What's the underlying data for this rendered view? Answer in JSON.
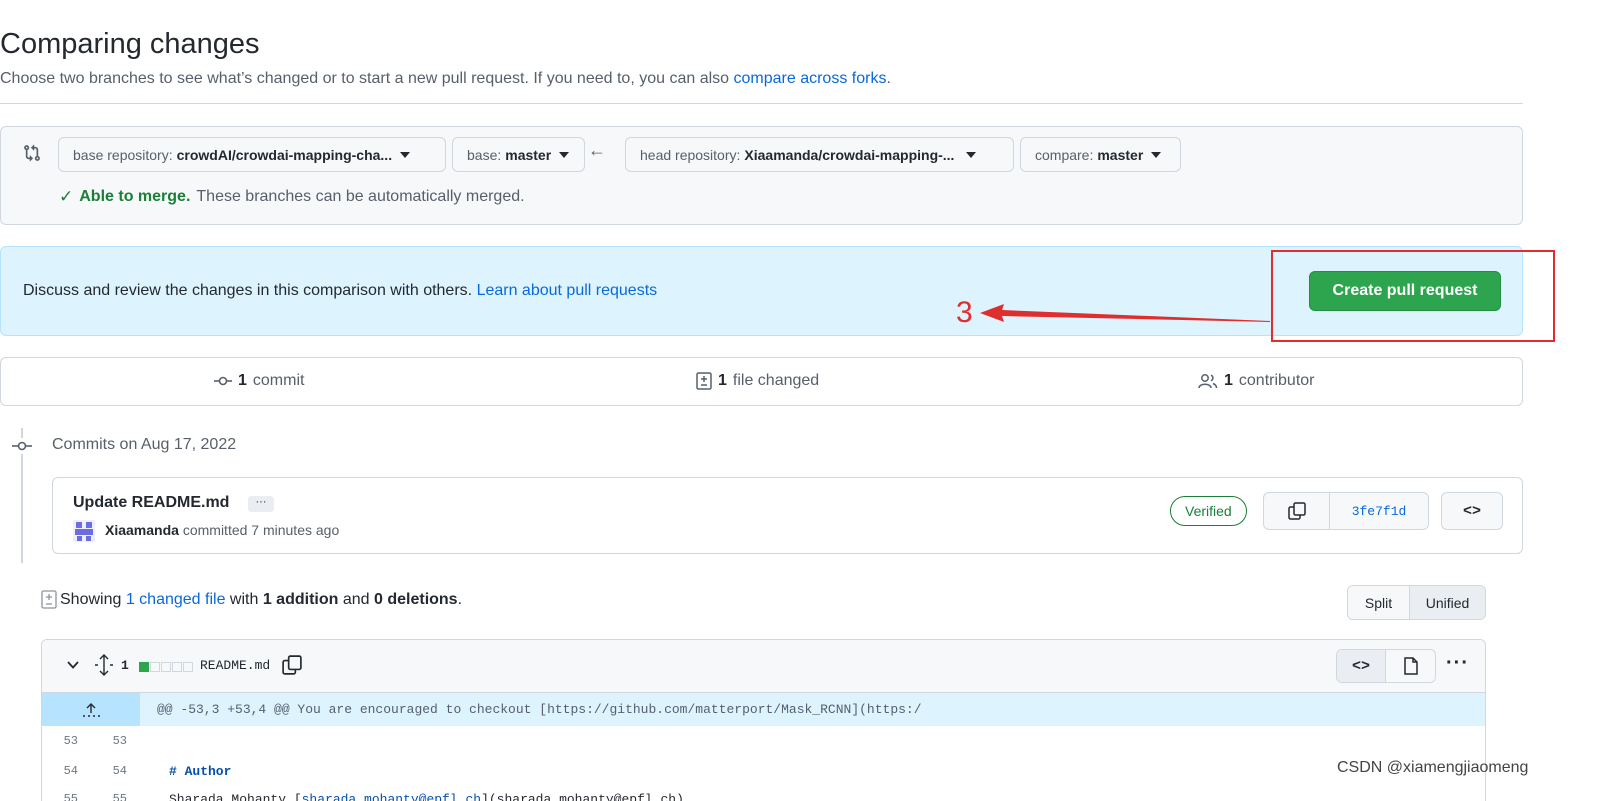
{
  "header": {
    "title": "Comparing changes",
    "subtitle": "Choose two branches to see what’s changed or to start a new pull request. If you need to, you can also",
    "subtitle_link": "compare across forks",
    "subtitle_end": "."
  },
  "range": {
    "base_repo_label": "base repository:",
    "base_repo_value": "crowdAI/crowdai-mapping-cha...",
    "base_label": "base:",
    "base_value": "master",
    "head_repo_label": "head repository:",
    "head_repo_value": "Xiaamanda/crowdai-mapping-...",
    "compare_label": "compare:",
    "compare_value": "master",
    "merge_ok": "Able to merge.",
    "merge_text": "These branches can be automatically merged."
  },
  "discuss": {
    "text": "Discuss and review the changes in this comparison with others.",
    "link": "Learn about pull requests",
    "button": "Create pull request"
  },
  "annotation": {
    "number": "3",
    "color": "#e02d2d"
  },
  "summary": {
    "commits_count": "1",
    "commits_label": "commit",
    "files_count": "1",
    "files_label": "file changed",
    "contributors_count": "1",
    "contributors_label": "contributor"
  },
  "commits": {
    "heading": "Commits on Aug 17, 2022",
    "title": "Update README.md",
    "ellipsis": "···",
    "author": "Xiaamanda",
    "meta": "committed 7 minutes ago",
    "verified": "Verified",
    "sha": "3fe7f1d",
    "browse": "<>"
  },
  "diff_stats": {
    "prefix": "Showing",
    "files_link": "1 changed file",
    "with": "with",
    "additions": "1 addition",
    "and": "and",
    "deletions": "0 deletions",
    "end": ".",
    "split_label": "Split",
    "unified_label": "Unified"
  },
  "file": {
    "count": "1",
    "name": "README.md",
    "code_btn": "<>",
    "more": "···",
    "hunk": "@@ -53,3 +53,4 @@ You are encouraged to checkout [https://github.com/matterport/Mask_RCNN](https:/",
    "lines": [
      {
        "old": "53",
        "new": "53",
        "text": ""
      },
      {
        "old": "54",
        "new": "54",
        "text": "# Author"
      },
      {
        "old": "55",
        "new": "55",
        "pre": "Sharada Mohanty [",
        "link": "sharada.mohanty@epfl.ch",
        "post": "](sharada.mohanty@epfl.ch)"
      }
    ]
  },
  "watermark": "CSDN @xiamengjiaomeng",
  "colors": {
    "accent": "#0969da",
    "success": "#2da44e",
    "annotation": "#e02d2d"
  }
}
